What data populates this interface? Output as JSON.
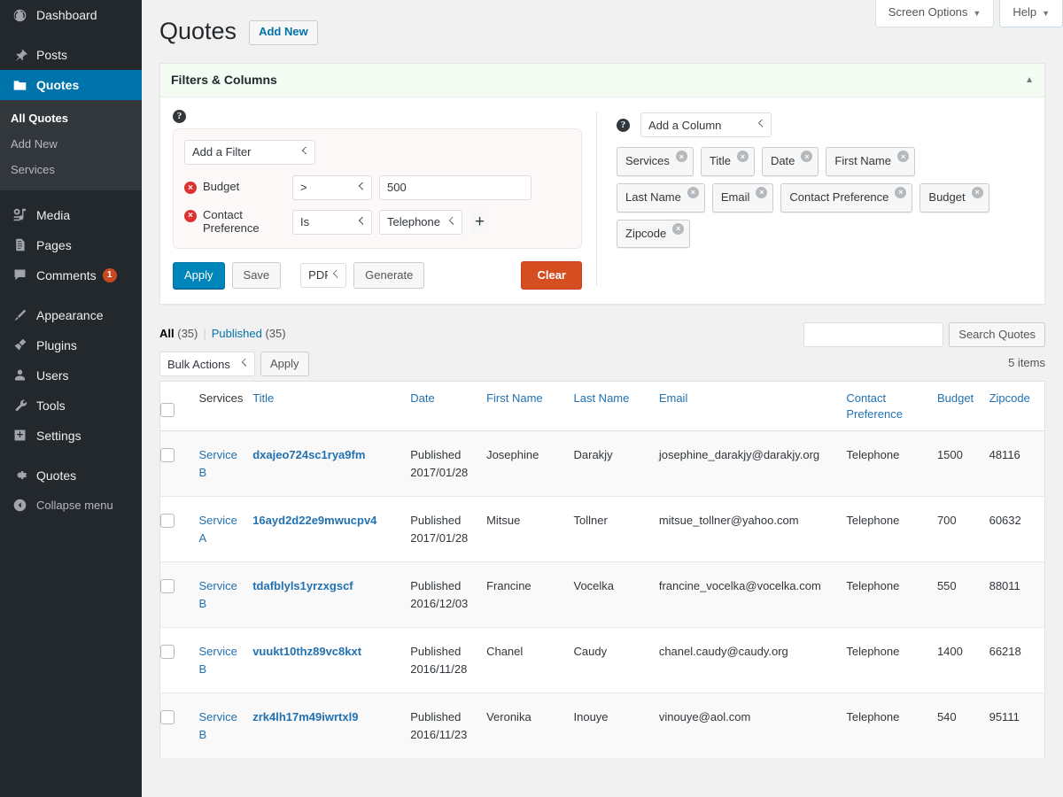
{
  "sidebar": {
    "items": [
      {
        "label": "Dashboard",
        "icon": "dashboard-icon",
        "state": "normal",
        "spaced": false
      },
      {
        "label": "Posts",
        "icon": "pin-icon",
        "state": "normal",
        "spaced": true
      },
      {
        "label": "Quotes",
        "icon": "folder-icon",
        "state": "current",
        "spaced": false
      },
      {
        "label": "Media",
        "icon": "media-icon",
        "state": "normal",
        "spaced": true
      },
      {
        "label": "Pages",
        "icon": "pages-icon",
        "state": "normal",
        "spaced": false
      },
      {
        "label": "Comments",
        "icon": "comments-icon",
        "state": "normal",
        "spaced": false,
        "badge": "1"
      },
      {
        "label": "Appearance",
        "icon": "brush-icon",
        "state": "normal",
        "spaced": true
      },
      {
        "label": "Plugins",
        "icon": "plug-icon",
        "state": "normal",
        "spaced": false
      },
      {
        "label": "Users",
        "icon": "users-icon",
        "state": "normal",
        "spaced": false
      },
      {
        "label": "Tools",
        "icon": "wrench-icon",
        "state": "normal",
        "spaced": false
      },
      {
        "label": "Settings",
        "icon": "settings-icon",
        "state": "normal",
        "spaced": false
      },
      {
        "label": "Quotes",
        "icon": "gear-icon",
        "state": "normal",
        "spaced": true
      },
      {
        "label": "Collapse menu",
        "icon": "collapse-icon",
        "state": "collapse",
        "spaced": false
      }
    ],
    "submenu": [
      {
        "label": "All Quotes",
        "current": true
      },
      {
        "label": "Add New",
        "current": false
      },
      {
        "label": "Services",
        "current": false
      }
    ],
    "colors": {
      "bg": "#23282d",
      "submenu_bg": "#32373c",
      "active": "#0073aa",
      "badge": "#ca4a1f"
    }
  },
  "screen_meta": {
    "screen_options": "Screen Options",
    "help": "Help",
    "caret": "▼"
  },
  "header": {
    "title": "Quotes",
    "add_new": "Add New"
  },
  "filters_panel": {
    "heading": "Filters & Columns",
    "toggle_arrow": "▲",
    "help_glyph": "?",
    "add_filter_label": "Add a Filter",
    "rows": [
      {
        "field": "Budget",
        "operator": "&gt;",
        "value": "500",
        "value_type": "text"
      },
      {
        "field": "Contact Preference",
        "operator": "Is",
        "value": "Telephone",
        "value_type": "select"
      }
    ],
    "add_row_glyph": "+",
    "buttons": {
      "apply": "Apply",
      "save": "Save",
      "format": "PDF",
      "generate": "Generate",
      "clear": "Clear"
    },
    "colors": {
      "apply": "#0085ba",
      "clear": "#d54e21",
      "panel_header": "#f3fbf3",
      "filter_box": "#fdf8f8"
    }
  },
  "columns_panel": {
    "add_column_label": "Add a Column",
    "help_glyph": "?",
    "tags": [
      "Services",
      "Title",
      "Date",
      "First Name",
      "Last Name",
      "Email",
      "Contact Preference",
      "Budget",
      "Zipcode"
    ],
    "remove_glyph": "×"
  },
  "list_table": {
    "views": [
      {
        "label": "All",
        "count": "(35)",
        "current": true
      },
      {
        "label": "Published",
        "count": "(35)",
        "current": false
      }
    ],
    "separator": "|",
    "search": {
      "value": "",
      "button": "Search Quotes"
    },
    "bulk_actions": "Bulk Actions",
    "apply": "Apply",
    "displaying_num": "5 items",
    "headers": [
      {
        "label": "Services",
        "sortable": false
      },
      {
        "label": "Title",
        "sortable": true
      },
      {
        "label": "Date",
        "sortable": true
      },
      {
        "label": "First Name",
        "sortable": true
      },
      {
        "label": "Last Name",
        "sortable": true
      },
      {
        "label": "Email",
        "sortable": true
      },
      {
        "label": "Contact Preference",
        "sortable": true
      },
      {
        "label": "Budget",
        "sortable": true
      },
      {
        "label": "Zipcode",
        "sortable": true
      }
    ],
    "rows": [
      {
        "services": "Service B",
        "title": "dxajeo724sc1rya9fm",
        "status": "Published",
        "date": "2017/01/28",
        "first_name": "Josephine",
        "last_name": "Darakjy",
        "email": "josephine_darakjy@darakjy.org",
        "contact_preference": "Telephone",
        "budget": "1500",
        "zipcode": "48116"
      },
      {
        "services": "Service A",
        "title": "16ayd2d22e9mwucpv4",
        "status": "Published",
        "date": "2017/01/28",
        "first_name": "Mitsue",
        "last_name": "Tollner",
        "email": "mitsue_tollner@yahoo.com",
        "contact_preference": "Telephone",
        "budget": "700",
        "zipcode": "60632"
      },
      {
        "services": "Service B",
        "title": "tdafblyls1yrzxgscf",
        "status": "Published",
        "date": "2016/12/03",
        "first_name": "Francine",
        "last_name": "Vocelka",
        "email": "francine_vocelka@vocelka.com",
        "contact_preference": "Telephone",
        "budget": "550",
        "zipcode": "88011"
      },
      {
        "services": "Service B",
        "title": "vuukt10thz89vc8kxt",
        "status": "Published",
        "date": "2016/11/28",
        "first_name": "Chanel",
        "last_name": "Caudy",
        "email": "chanel.caudy@caudy.org",
        "contact_preference": "Telephone",
        "budget": "1400",
        "zipcode": "66218"
      },
      {
        "services": "Service B",
        "title": "zrk4lh17m49iwrtxl9",
        "status": "Published",
        "date": "2016/11/23",
        "first_name": "Veronika",
        "last_name": "Inouye",
        "email": "vinouye@aol.com",
        "contact_preference": "Telephone",
        "budget": "540",
        "zipcode": "95111"
      }
    ]
  }
}
